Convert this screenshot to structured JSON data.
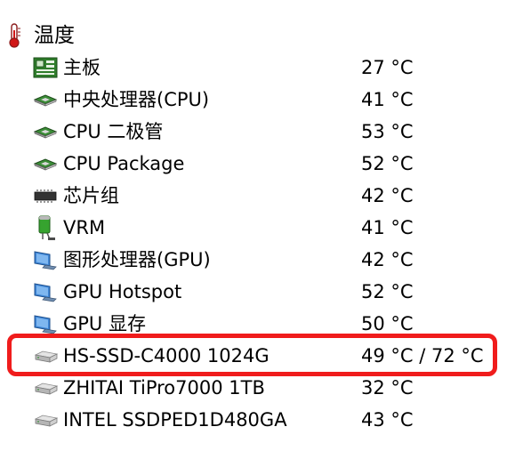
{
  "colors": {
    "highlight": "#f01c1c",
    "chip": "#2f7d2b",
    "monitor": "#3f86d6"
  },
  "root": {
    "label": "温度",
    "icon": "thermometer-icon"
  },
  "items": [
    {
      "label": "主板",
      "value": "27 °C",
      "icon": "motherboard-icon"
    },
    {
      "label": "中央处理器(CPU)",
      "value": "41 °C",
      "icon": "cpu-chip-icon"
    },
    {
      "label": "CPU 二极管",
      "value": "53 °C",
      "icon": "cpu-chip-icon"
    },
    {
      "label": "CPU Package",
      "value": "52 °C",
      "icon": "cpu-chip-icon"
    },
    {
      "label": "芯片组",
      "value": "42 °C",
      "icon": "chipset-icon"
    },
    {
      "label": "VRM",
      "value": "41 °C",
      "icon": "vrm-capacitor-icon"
    },
    {
      "label": "图形处理器(GPU)",
      "value": "42 °C",
      "icon": "gpu-monitor-icon"
    },
    {
      "label": "GPU Hotspot",
      "value": "52 °C",
      "icon": "gpu-monitor-icon"
    },
    {
      "label": "GPU 显存",
      "value": "50 °C",
      "icon": "gpu-monitor-icon"
    },
    {
      "label": "HS-SSD-C4000 1024G",
      "value": "49 °C / 72 °C",
      "icon": "drive-icon"
    },
    {
      "label": "ZHITAI TiPro7000 1TB",
      "value": "32 °C",
      "icon": "drive-icon"
    },
    {
      "label": "INTEL SSDPED1D480GA",
      "value": "43 °C",
      "icon": "drive-icon"
    }
  ]
}
